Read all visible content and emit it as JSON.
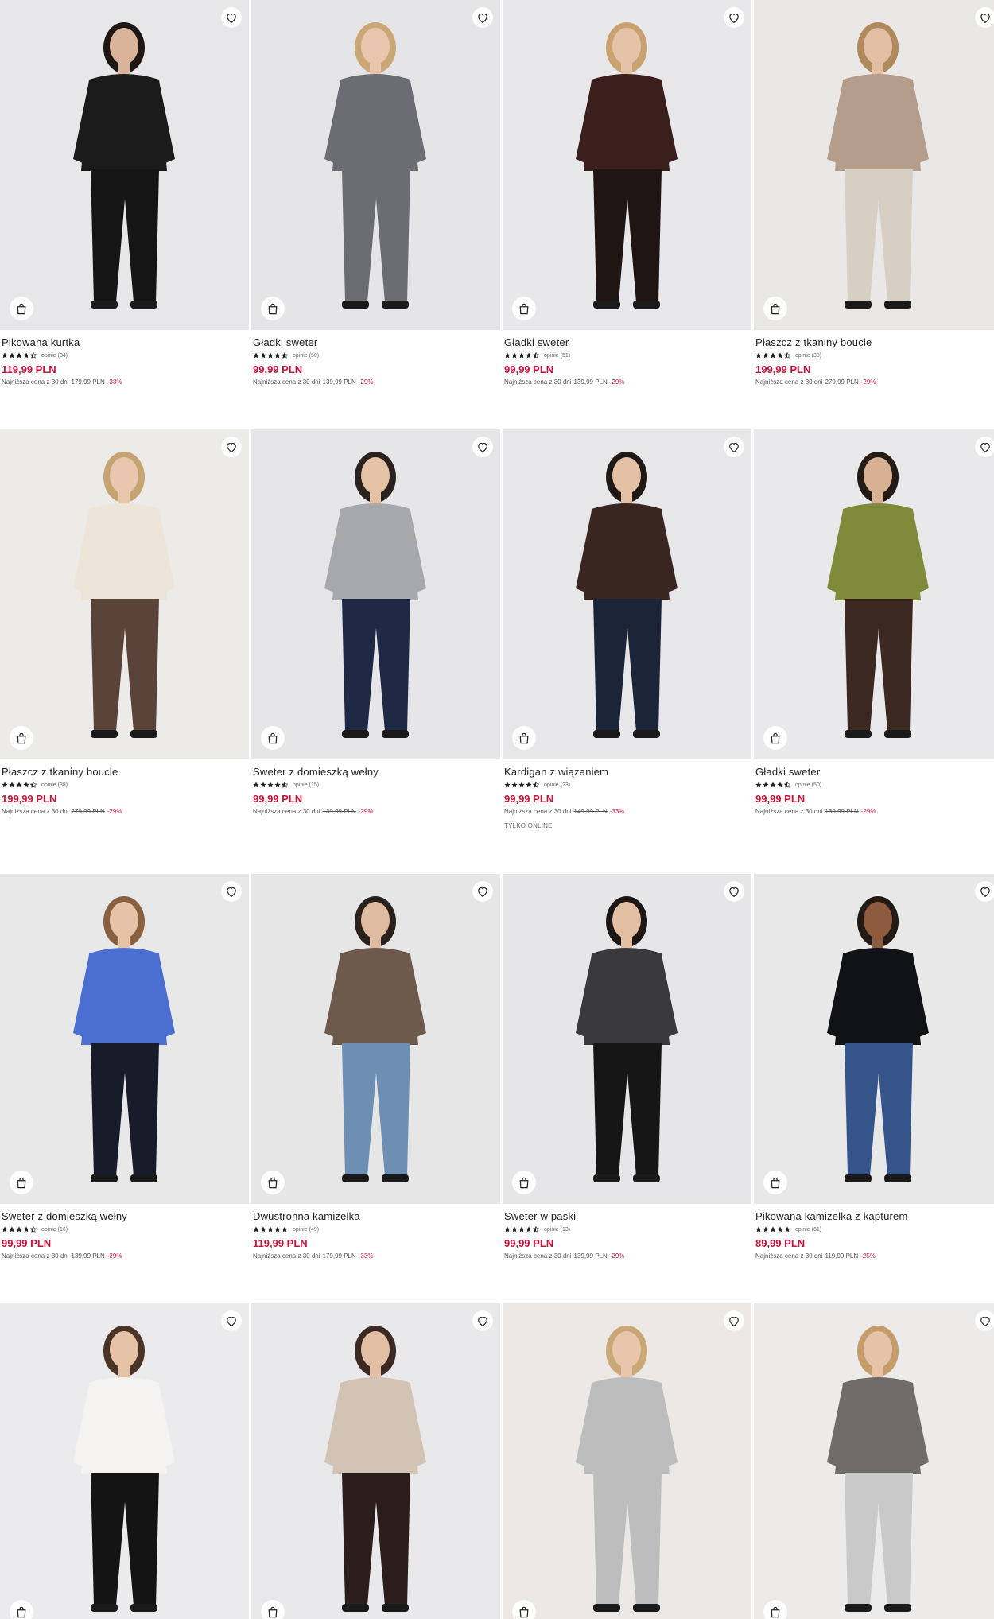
{
  "products": [
    {
      "name": "Pikowana kurtka",
      "rating": 4.5,
      "reviews": "opinie (34)",
      "price": "119,99 PLN",
      "lowest_label": "Najniższa cena z 30 dni",
      "old_price": "179,99 PLN",
      "discount": "-33%",
      "online": "",
      "bg": "#e7e7e9",
      "top": "#1b1b1c",
      "bottom": "#151515",
      "skin": "#d9b49a",
      "hair": "#1e1714"
    },
    {
      "name": "Gładki sweter",
      "rating": 4.5,
      "reviews": "opinie (50)",
      "price": "99,99 PLN",
      "lowest_label": "Najniższa cena z 30 dni",
      "old_price": "139,99 PLN",
      "discount": "-29%",
      "online": "",
      "bg": "#e5e4e6",
      "top": "#6b6d72",
      "bottom": "#6b6d72",
      "skin": "#e9c6ad",
      "hair": "#c9a776"
    },
    {
      "name": "Gładki sweter",
      "rating": 4.5,
      "reviews": "opinie (51)",
      "price": "99,99 PLN",
      "lowest_label": "Najniższa cena z 30 dni",
      "old_price": "139,99 PLN",
      "discount": "-29%",
      "online": "",
      "bg": "#e8e8ea",
      "top": "#3b1f1c",
      "bottom": "#1f1513",
      "skin": "#e6c3a8",
      "hair": "#c8a371"
    },
    {
      "name": "Płaszcz z tkaniny boucle",
      "rating": 4.5,
      "reviews": "opinie (38)",
      "price": "199,99 PLN",
      "lowest_label": "Najniższa cena z 30 dni",
      "old_price": "279,99 PLN",
      "discount": "-29%",
      "online": "",
      "bg": "#eae8e6",
      "top": "#b49e8b",
      "bottom": "#d8cfc4",
      "skin": "#e2bea2",
      "hair": "#b08a5e"
    },
    {
      "name": "Płaszcz z tkaniny boucle",
      "rating": 4.5,
      "reviews": "opinie (38)",
      "price": "199,99 PLN",
      "lowest_label": "Najniższa cena z 30 dni",
      "old_price": "279,99 PLN",
      "discount": "-29%",
      "online": "",
      "bg": "#ecebe8",
      "top": "#ede6d8",
      "bottom": "#5a4439",
      "skin": "#e8c7ae",
      "hair": "#c6a372"
    },
    {
      "name": "Sweter z domieszką wełny",
      "rating": 4.5,
      "reviews": "opinie (15)",
      "price": "99,99 PLN",
      "lowest_label": "Najniższa cena z 30 dni",
      "old_price": "139,99 PLN",
      "discount": "-29%",
      "online": "",
      "bg": "#e6e6e8",
      "top": "#a7a8ab",
      "bottom": "#1e2a45",
      "skin": "#e5c1a6",
      "hair": "#2a221e"
    },
    {
      "name": "Kardigan z wiązaniem",
      "rating": 4.5,
      "reviews": "opinie (23)",
      "price": "99,99 PLN",
      "lowest_label": "Najniższa cena z 30 dni",
      "old_price": "149,99 PLN",
      "discount": "-33%",
      "online": "TYLKO ONLINE",
      "bg": "#e7e7e9",
      "top": "#3a2620",
      "bottom": "#1c2538",
      "skin": "#e4c0a4",
      "hair": "#1f1815"
    },
    {
      "name": "Gładki sweter",
      "rating": 4.5,
      "reviews": "opinie (50)",
      "price": "99,99 PLN",
      "lowest_label": "Najniższa cena z 30 dni",
      "old_price": "139,99 PLN",
      "discount": "-29%",
      "online": "",
      "bg": "#e9e9eb",
      "top": "#7f8a3a",
      "bottom": "#3b2820",
      "skin": "#d8b193",
      "hair": "#241b17"
    },
    {
      "name": "Sweter z domieszką wełny",
      "rating": 4.5,
      "reviews": "opinie (16)",
      "price": "99,99 PLN",
      "lowest_label": "Najniższa cena z 30 dni",
      "old_price": "139,99 PLN",
      "discount": "-29%",
      "online": "",
      "bg": "#e9e8e8",
      "top": "#4b6fd1",
      "bottom": "#181c2a",
      "skin": "#e6c2a6",
      "hair": "#8a6140"
    },
    {
      "name": "Dwustronna kamizelka",
      "rating": 5,
      "reviews": "opinie (49)",
      "price": "119,99 PLN",
      "lowest_label": "Najniższa cena z 30 dni",
      "old_price": "179,99 PLN",
      "discount": "-33%",
      "online": "",
      "bg": "#e6e6e7",
      "top": "#6e5a4c",
      "bottom": "#6d8fb3",
      "skin": "#dfbb9f",
      "hair": "#2b211c"
    },
    {
      "name": "Sweter w paski",
      "rating": 4.5,
      "reviews": "opinie (13)",
      "price": "99,99 PLN",
      "lowest_label": "Najniższa cena z 30 dni",
      "old_price": "139,99 PLN",
      "discount": "-29%",
      "online": "",
      "bg": "#e6e6e8",
      "top": "#3a3a3c",
      "bottom": "#161616",
      "skin": "#e2bea3",
      "hair": "#1c1614"
    },
    {
      "name": "Pikowana kamizelka z kapturem",
      "rating": 5,
      "reviews": "opinie (61)",
      "price": "89,99 PLN",
      "lowest_label": "Najniższa cena z 30 dni",
      "old_price": "119,99 PLN",
      "discount": "-25%",
      "online": "",
      "bg": "#e8e8e9",
      "top": "#111216",
      "bottom": "#34548a",
      "skin": "#8d5b3e",
      "hair": "#231a15"
    },
    {
      "name": "",
      "rating": 0,
      "reviews": "",
      "price": "",
      "lowest_label": "",
      "old_price": "",
      "discount": "",
      "online": "",
      "bg": "#ebebed",
      "top": "#f4f3f1",
      "bottom": "#141414",
      "skin": "#e5c1a5",
      "hair": "#4a3426"
    },
    {
      "name": "",
      "rating": 0,
      "reviews": "",
      "price": "",
      "lowest_label": "",
      "old_price": "",
      "discount": "",
      "online": "",
      "bg": "#e9e9eb",
      "top": "#d2c3b4",
      "bottom": "#2b1e1a",
      "skin": "#e3bfa3",
      "hair": "#3a2a22"
    },
    {
      "name": "",
      "rating": 0,
      "reviews": "",
      "price": "",
      "lowest_label": "",
      "old_price": "",
      "discount": "",
      "online": "",
      "bg": "#ebe8e5",
      "top": "#bdbdbe",
      "bottom": "#bdbdbe",
      "skin": "#e8c5ab",
      "hair": "#c9a776"
    },
    {
      "name": "",
      "rating": 0,
      "reviews": "",
      "price": "",
      "lowest_label": "",
      "old_price": "",
      "discount": "",
      "online": "",
      "bg": "#ecebe9",
      "top": "#6f6c69",
      "bottom": "#c9c9c9",
      "skin": "#e6c3a8",
      "hair": "#c49d6b"
    }
  ]
}
